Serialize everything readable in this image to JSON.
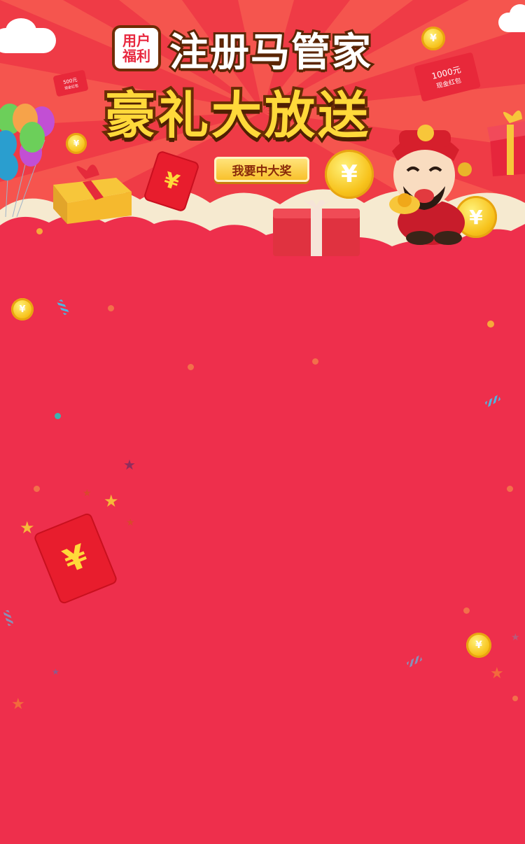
{
  "colors": {
    "background": "#ee2f4c",
    "ray_light": "#f6584f",
    "ray_dark": "#ef3b46",
    "title_white": "#ffffff",
    "title_gold": "#ffd93a",
    "outline_brown": "#5a2504",
    "badge_red": "#e8283f",
    "cta_text": "#8a2a0a"
  },
  "header": {
    "badge_line1": "用户",
    "badge_line2": "福利",
    "title_line1": "注册马管家",
    "title_line2": "豪礼大放送"
  },
  "cta": {
    "label": "我要中大奖"
  },
  "envelopes": {
    "small_left_amount": "500元",
    "small_left_sub": "现金红包",
    "small_right_amount": "1000元",
    "small_right_sub": "现金红包",
    "yuan_symbol": "¥"
  },
  "coin_symbol": "¥",
  "decor": {
    "balloon_icon": "balloons-icon",
    "gift_icon": "gift-box-icon",
    "god_of_wealth_icon": "god-of-wealth-icon",
    "cloud_icon": "cloud-icon",
    "star_icon": "star-icon",
    "confetti_icon": "confetti-icon"
  }
}
